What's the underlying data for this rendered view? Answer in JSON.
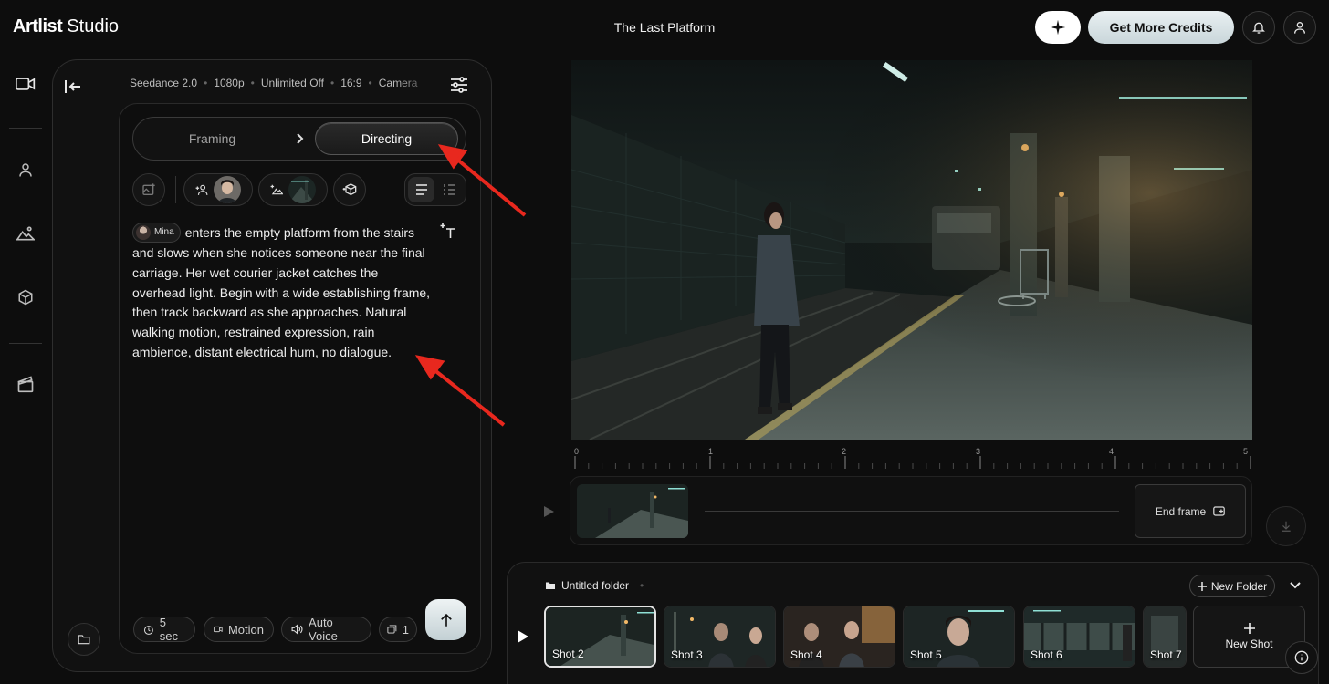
{
  "app": {
    "brand_bold": "Artlist",
    "brand_light": "Studio",
    "project_title": "The Last Platform"
  },
  "header": {
    "credits_label": "Get More Credits"
  },
  "panel": {
    "meta": [
      "Seedance 2.0",
      "1080p",
      "Unlimited Off",
      "16:9",
      "Camera"
    ],
    "tabs": {
      "framing": "Framing",
      "directing": "Directing",
      "active": "Directing"
    },
    "mention": "Mina",
    "prompt_text": "enters the empty platform from the stairs and slows when she notices someone near the final carriage. Her wet courier jacket catches the overhead light. Begin with a wide establishing frame, then track backward as she approaches. Natural walking motion, restrained expression, rain ambience, distant electrical hum, no dialogue.",
    "chips": {
      "duration": "5 sec",
      "motion": "Motion",
      "auto_voice": "Auto Voice",
      "count": "1"
    }
  },
  "timeline": {
    "ticks": [
      "0",
      "1",
      "2",
      "3",
      "4",
      "5"
    ],
    "end_frame": "End frame"
  },
  "shots": {
    "folder": "Untitled folder",
    "new_folder": "New Folder",
    "items": [
      "Shot 2",
      "Shot 3",
      "Shot 4",
      "Shot 5",
      "Shot 6",
      "Shot 7"
    ],
    "selected": "Shot 2",
    "new_shot": "New Shot"
  },
  "colors": {
    "accent_arrow": "#e8281e",
    "credits_btn": "#d6e1e4",
    "background": "#0d0d0d"
  }
}
